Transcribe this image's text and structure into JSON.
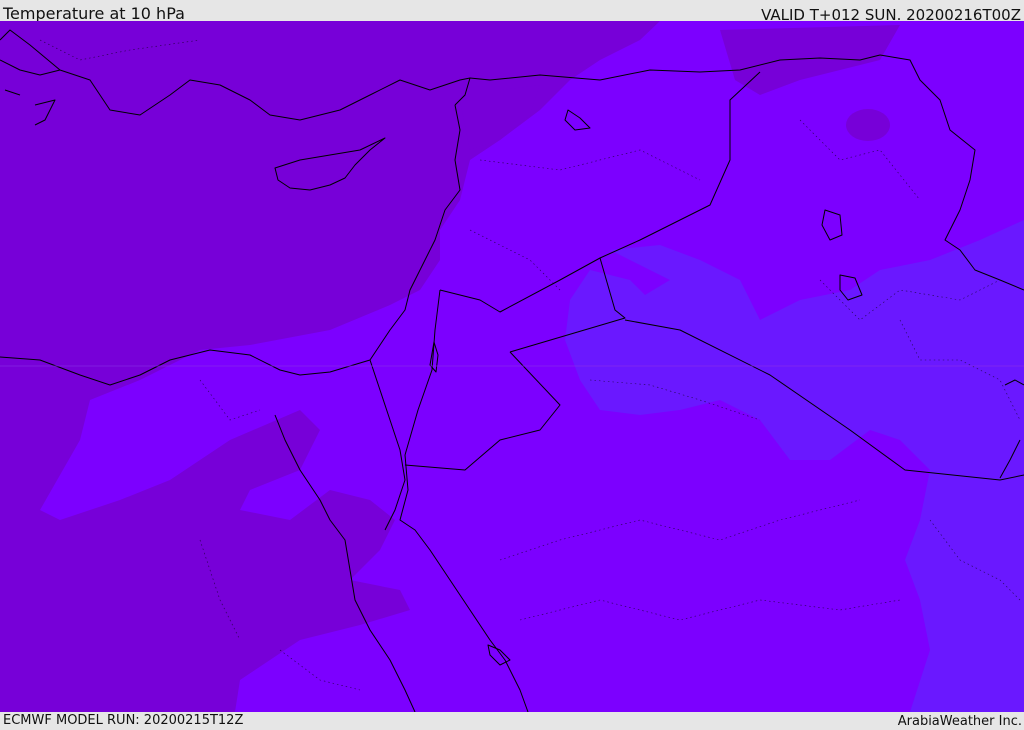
{
  "header": {
    "title": "Temperature at 10 hPa",
    "valid": "VALID T+012 SUN. 20200216T00Z"
  },
  "footer": {
    "model_run": "ECMWF MODEL RUN: 20200215T12Z",
    "credit": "ArabiaWeather Inc."
  },
  "map": {
    "field": "temperature",
    "level": "10 hPa",
    "colors": {
      "band_warm": "#7700d8",
      "band_mid": "#7c00ff",
      "band_cool": "#6a18ff",
      "coastline": "#000000"
    }
  }
}
